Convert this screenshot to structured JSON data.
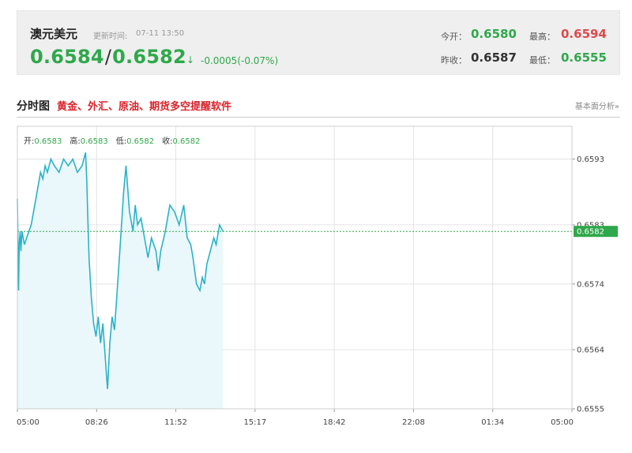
{
  "quote": {
    "name": "澳元美元",
    "time_label": "更新时间:",
    "time": "07-11 13:50",
    "bid": "0.6584",
    "ask": "0.6582",
    "arrow": "↓",
    "change": "-0.0005(-0.07%)",
    "open_label": "今开：",
    "open": "0.6580",
    "high_label": "最高：",
    "high": "0.6594",
    "prev_label": "昨收：",
    "prev": "0.6587",
    "low_label": "最低：",
    "low": "0.6555"
  },
  "section": {
    "title": "分时图",
    "link": "黄金、外汇、原油、期货多空提醒软件",
    "right_link": "基本面分析»"
  },
  "ohlc_bar": {
    "open_label": "开:",
    "open": "0.6583",
    "high_label": "高:",
    "high": "0.6583",
    "low_label": "低:",
    "low": "0.6582",
    "close_label": "收:",
    "close": "0.6582"
  },
  "colors": {
    "line": "#29b3c8",
    "fill": "#eaf7fb",
    "grid": "#e3e3e3",
    "current_line": "#2ea84a",
    "green": "#2ea84a",
    "red": "#e0484b"
  },
  "chart_data": {
    "type": "area",
    "ylim": [
      0.6555,
      0.6598
    ],
    "xlim_hours": [
      0,
      24
    ],
    "current_price": 0.6582,
    "x_ticks": [
      "05:00",
      "08:26",
      "11:52",
      "15:17",
      "18:42",
      "22:08",
      "01:34",
      "05:00"
    ],
    "y_ticks": [
      "0.6593",
      "0.6583",
      "0.6574",
      "0.6564",
      "0.6555"
    ],
    "current_label": "0.6582",
    "series": [
      {
        "x": [
          0,
          0.05,
          0.08,
          0.12,
          0.15,
          0.2,
          0.3,
          0.4,
          0.5,
          0.6,
          0.7,
          0.85,
          1.0,
          1.1,
          1.2,
          1.3,
          1.45,
          1.6,
          1.8,
          2.0,
          2.2,
          2.4,
          2.6,
          2.8,
          2.95,
          3.0,
          3.05,
          3.1,
          3.2,
          3.3,
          3.4,
          3.5,
          3.6,
          3.7,
          3.8,
          3.9,
          4.0,
          4.1,
          4.2,
          4.3,
          4.45,
          4.6,
          4.7,
          4.85,
          5.0,
          5.1,
          5.2,
          5.35,
          5.5,
          5.65,
          5.8,
          6.0,
          6.1,
          6.2,
          6.4,
          6.6,
          6.8,
          7.0,
          7.2,
          7.35,
          7.5,
          7.6,
          7.75,
          7.9,
          8.0,
          8.1,
          8.2,
          8.35,
          8.5,
          8.6,
          8.75,
          8.9
        ],
        "y": [
          0.6587,
          0.6573,
          0.658,
          0.6582,
          0.6579,
          0.6582,
          0.658,
          0.6581,
          0.6582,
          0.6583,
          0.6585,
          0.6588,
          0.6591,
          0.659,
          0.6592,
          0.6591,
          0.6593,
          0.6592,
          0.6591,
          0.6593,
          0.6592,
          0.6593,
          0.6591,
          0.6592,
          0.6594,
          0.659,
          0.6584,
          0.6578,
          0.6572,
          0.6568,
          0.6566,
          0.6569,
          0.6565,
          0.6568,
          0.6563,
          0.6558,
          0.6565,
          0.6569,
          0.6567,
          0.6572,
          0.658,
          0.6588,
          0.6592,
          0.6585,
          0.6582,
          0.6586,
          0.6583,
          0.6584,
          0.6581,
          0.6578,
          0.6581,
          0.6579,
          0.6576,
          0.6579,
          0.6582,
          0.6586,
          0.6585,
          0.6583,
          0.6586,
          0.6581,
          0.658,
          0.6578,
          0.6574,
          0.6573,
          0.6575,
          0.6574,
          0.6577,
          0.6579,
          0.6581,
          0.658,
          0.6583,
          0.6582
        ]
      }
    ]
  }
}
